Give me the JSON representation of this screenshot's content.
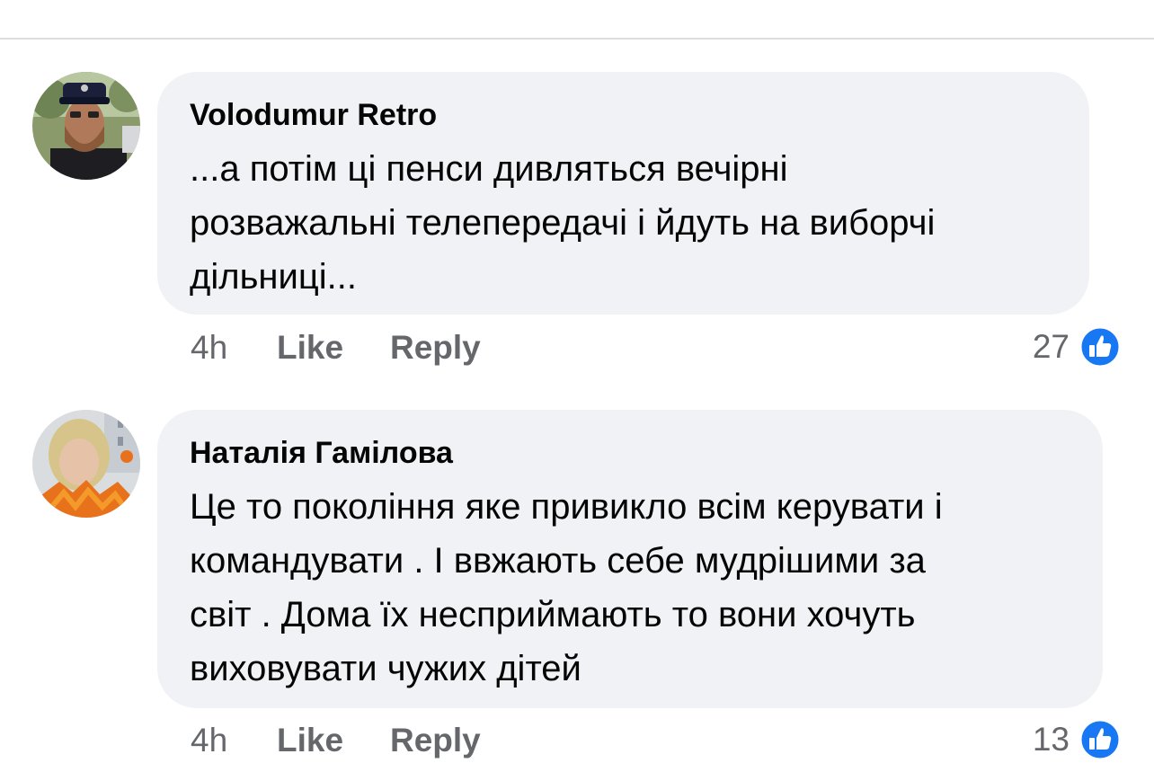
{
  "comments": [
    {
      "author": "Volodumur Retro",
      "lines": [
        "...а потім ці пенси дивляться вечірні",
        "розважальні телепередачі і йдуть на виборчі",
        "дільниці..."
      ],
      "time": "4h",
      "like_label": "Like",
      "reply_label": "Reply",
      "reaction_count": "27",
      "reaction_icon": "like-reaction-icon",
      "avatar": "avatar-man-in-cap"
    },
    {
      "author": "Наталія Гамілова",
      "lines": [
        "Це то покоління яке привикло всім керувати і",
        "командувати . І ввжають себе мудрішими за",
        "світ . Дома їх несприймають то вони хочуть",
        "виховувати чужих дітей"
      ],
      "time": "4h",
      "like_label": "Like",
      "reply_label": "Reply",
      "reaction_count": "13",
      "reaction_icon": "like-reaction-icon",
      "avatar": "avatar-woman-with-flowers"
    }
  ],
  "colors": {
    "bubble": "#f0f2f5",
    "text": "#050505",
    "meta": "#65676b",
    "like_blue": "#1877f2"
  }
}
